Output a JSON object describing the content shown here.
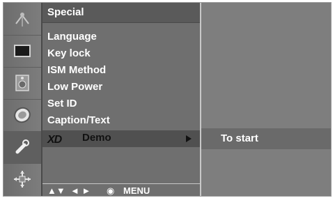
{
  "menu": {
    "title": "Special",
    "items": [
      {
        "label": "Language"
      },
      {
        "label": "Key lock"
      },
      {
        "label": "ISM Method"
      },
      {
        "label": "Low Power"
      },
      {
        "label": "Set ID"
      },
      {
        "label": "Caption/Text"
      }
    ],
    "selected": {
      "logo": "XD",
      "label": "Demo"
    }
  },
  "footer": {
    "updown": "▲▼",
    "leftright": "◄ ►",
    "ok": "◉",
    "menu": "MENU"
  },
  "panel": {
    "hint": "To start"
  },
  "icons": [
    "antenna-icon",
    "screen-icon",
    "speaker-icon",
    "clock-icon",
    "special-icon",
    "settings-icon"
  ],
  "colors": {
    "osd_bg": "#7a7a7a",
    "selection": "#505050",
    "text": "#ffffff"
  }
}
